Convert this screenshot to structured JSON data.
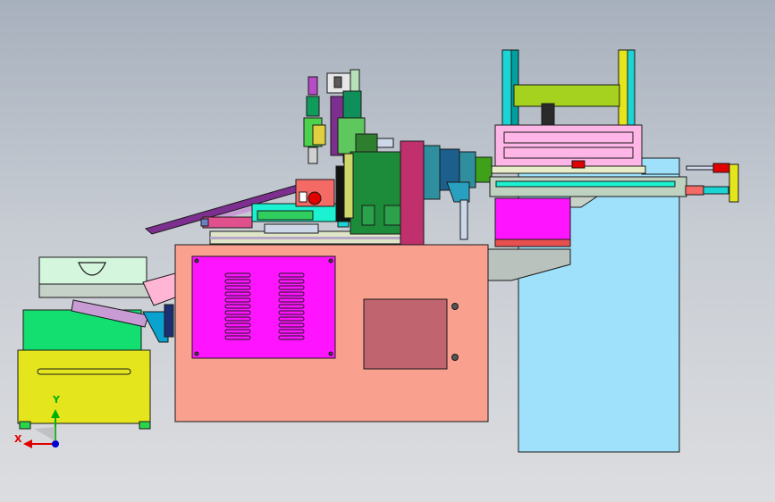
{
  "viewport": {
    "colors": {
      "bg_top": "#a7b0bd",
      "bg_bottom": "#dcdde0",
      "frame_body": "#f9a08f",
      "control_panel": "#ff14ff",
      "base_green": "#12df6f",
      "bin_yellow": "#e5e51e",
      "stand_blue": "#9fe0fb",
      "hub_teal": "#2f8f9f",
      "feeder_purple": "#7d2f8f"
    }
  },
  "triad": {
    "x_label": "X",
    "y_label": "Y",
    "x_color": "#e00000",
    "y_color": "#00b000",
    "z_color": "#0000d0"
  }
}
